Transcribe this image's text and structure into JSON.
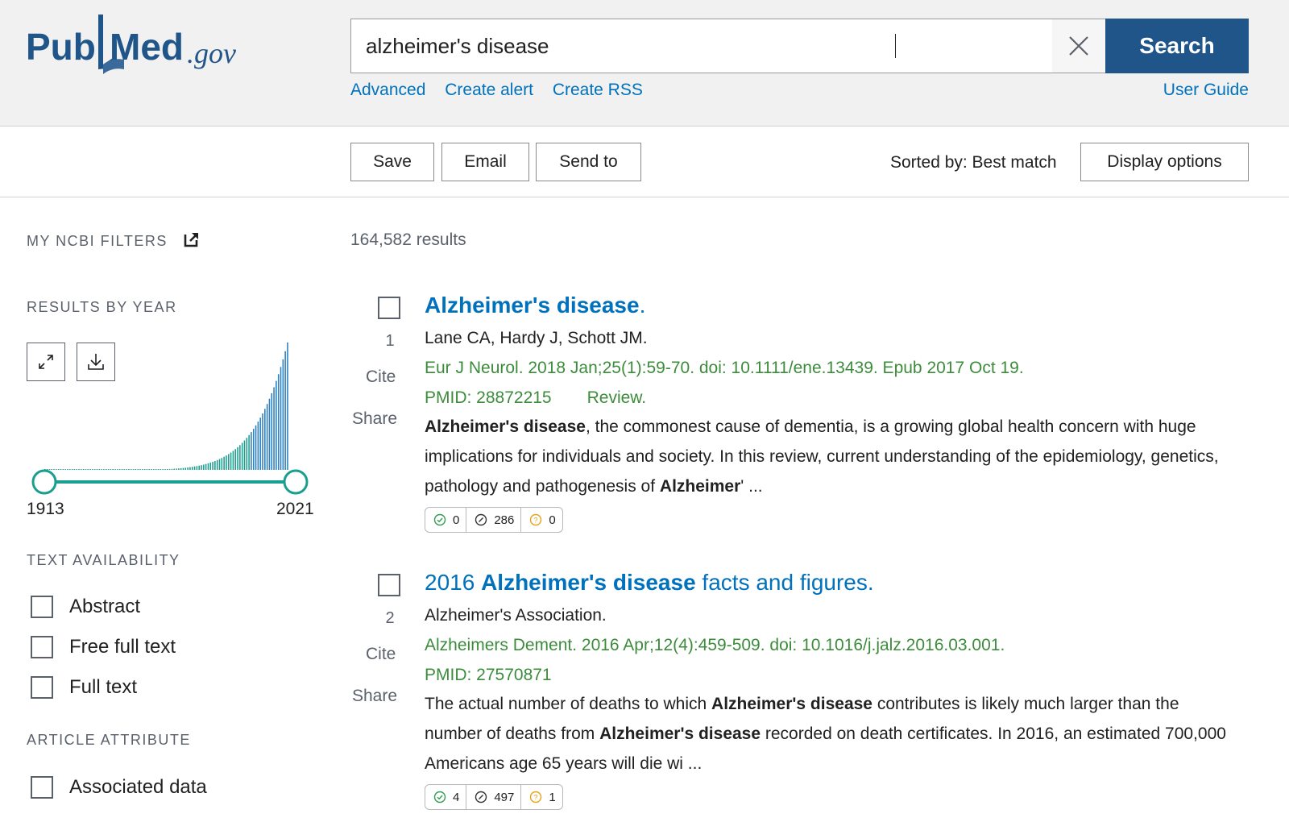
{
  "header": {
    "logo_pub": "Pub",
    "logo_med": "Med",
    "logo_gov": ".gov",
    "search_value": "alzheimer's disease",
    "search_button": "Search",
    "links": [
      "Advanced",
      "Create alert",
      "Create RSS"
    ],
    "user_guide": "User Guide"
  },
  "toolbar": {
    "save": "Save",
    "email": "Email",
    "send_to": "Send to",
    "sorted_by": "Sorted by: Best match",
    "display_options": "Display options"
  },
  "sidebar": {
    "my_ncbi_filters": "MY NCBI FILTERS",
    "results_by_year": "RESULTS BY YEAR",
    "year_start": "1913",
    "year_end": "2021",
    "text_availability": "TEXT AVAILABILITY",
    "text_filters": [
      "Abstract",
      "Free full text",
      "Full text"
    ],
    "article_attribute": "ARTICLE ATTRIBUTE",
    "attribute_filters": [
      "Associated data"
    ],
    "histogram_colors": {
      "teal": "#1a9e8f",
      "blue": "#2a7fc1"
    }
  },
  "results": {
    "count": "164,582 results",
    "items": [
      {
        "num": "1",
        "cite": "Cite",
        "share": "Share",
        "title_bold": "Alzheimer's disease",
        "title_rest": ".",
        "authors": "Lane CA, Hardy J, Schott JM.",
        "journal": "Eur J Neurol. 2018 Jan;25(1):59-70. doi: 10.1111/ene.13439. Epub 2017 Oct 19.",
        "pmid": "PMID: 28872215",
        "ptype": "Review.",
        "snippet_b1": "Alzheimer's disease",
        "snippet_t1": ", the commonest cause of dementia, is a growing global health concern with huge implications for individuals and society. In this review, current understanding of the epidemiology, genetics, pathology and pathogenesis of ",
        "snippet_b2": "Alzheimer",
        "snippet_t2": "' ...",
        "badges": [
          "0",
          "286",
          "0"
        ]
      },
      {
        "num": "2",
        "cite": "Cite",
        "share": "Share",
        "title_pre": "2016 ",
        "title_bold": "Alzheimer's disease",
        "title_rest": " facts and figures.",
        "authors": "Alzheimer's Association.",
        "journal": "Alzheimers Dement. 2016 Apr;12(4):459-509. doi: 10.1016/j.jalz.2016.03.001.",
        "pmid": "PMID: 27570871",
        "snippet_t0": "The actual number of deaths to which ",
        "snippet_b1": "Alzheimer's disease",
        "snippet_t1": " contributes is likely much larger than the number of deaths from ",
        "snippet_b2": "Alzheimer's disease",
        "snippet_t2": " recorded on death certificates. In 2016, an estimated 700,000 Americans age 65 years will die wi ...",
        "badges": [
          "4",
          "497",
          "1"
        ]
      }
    ]
  }
}
